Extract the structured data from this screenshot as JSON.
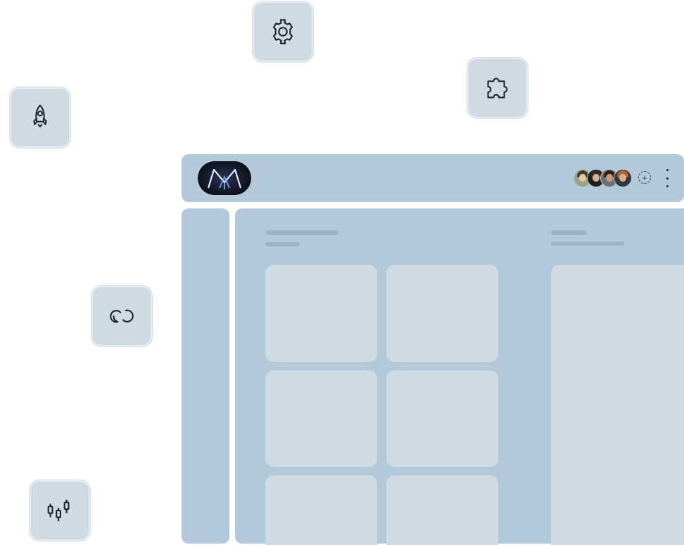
{
  "floating_icons": {
    "gear": "gear-icon",
    "puzzle": "puzzle-icon",
    "rocket": "rocket-icon",
    "link": "link-icon",
    "candlestick": "candlestick-chart-icon"
  },
  "header": {
    "logo": "app-logo",
    "avatars": [
      "avatar-1",
      "avatar-2",
      "avatar-3",
      "avatar-4"
    ],
    "add_member_symbol": "+",
    "more_menu": "more-vertical-icon"
  },
  "colors": {
    "panel": "#b3c9d9",
    "card": "#cedbe3",
    "skeleton": "#9fb3c2",
    "tile_border": "#e6edf1"
  }
}
